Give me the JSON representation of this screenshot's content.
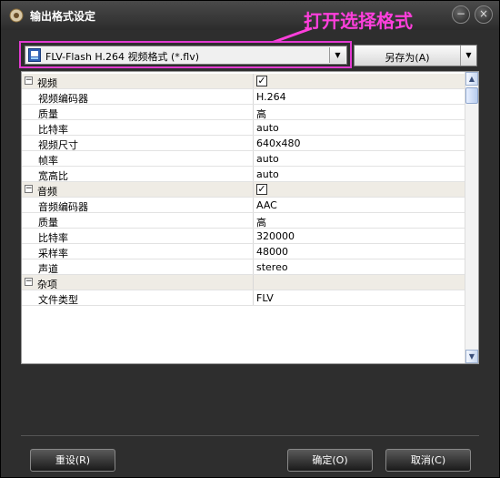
{
  "window": {
    "title": "输出格式设定",
    "minimize_glyph": "−",
    "close_glyph": "×"
  },
  "annotation": {
    "text": "打开选择格式",
    "color": "#ff3fdc"
  },
  "format": {
    "selected": "FLV-Flash H.264 视频格式 (*.flv)",
    "icon": "flv-file-icon"
  },
  "save_as": {
    "label": "另存为(A)"
  },
  "properties": [
    {
      "kind": "category",
      "label": "视频",
      "toggle": "⊟",
      "checked": true
    },
    {
      "kind": "prop",
      "label": "视频编码器",
      "value": "H.264"
    },
    {
      "kind": "prop",
      "label": "质量",
      "value": "高"
    },
    {
      "kind": "prop",
      "label": "比特率",
      "value": "auto"
    },
    {
      "kind": "prop",
      "label": "视频尺寸",
      "value": "640x480"
    },
    {
      "kind": "prop",
      "label": "帧率",
      "value": "auto"
    },
    {
      "kind": "prop",
      "label": "宽高比",
      "value": "auto"
    },
    {
      "kind": "category",
      "label": "音频",
      "toggle": "⊟",
      "checked": true
    },
    {
      "kind": "prop",
      "label": "音频编码器",
      "value": "AAC"
    },
    {
      "kind": "prop",
      "label": "质量",
      "value": "高"
    },
    {
      "kind": "prop",
      "label": "比特率",
      "value": "320000"
    },
    {
      "kind": "prop",
      "label": "采样率",
      "value": "48000"
    },
    {
      "kind": "prop",
      "label": "声道",
      "value": "stereo"
    },
    {
      "kind": "category",
      "label": "杂项",
      "toggle": "⊟"
    },
    {
      "kind": "prop",
      "label": "文件类型",
      "value": "FLV"
    }
  ],
  "buttons": {
    "reset": "重设(R)",
    "ok": "确定(O)",
    "cancel": "取消(C)"
  }
}
